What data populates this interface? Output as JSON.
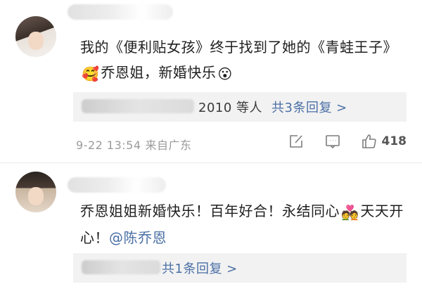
{
  "comments": [
    {
      "text_before": "我的《便利贴女孩》终于找到了她的《青蛙王子》",
      "emoji1": "🥰",
      "text_mid": "乔恩姐，新婚快乐",
      "emoji2": "😮",
      "reply_suffix": "2010 等人",
      "reply_count": "共3条回复 >",
      "timestamp": "9-22 13:54",
      "location": "来自广东",
      "likes": "418"
    },
    {
      "text_before": "乔恩姐姐新婚快乐！百年好合！永结同心",
      "emoji1": "💑",
      "text_mid": "天天开心！",
      "mention": "@陈乔恩",
      "reply_count": "共1条回复 >"
    }
  ],
  "icons": {
    "share": "share-icon",
    "comment": "comment-icon",
    "like": "thumbs-up-icon"
  },
  "colors": {
    "link": "#4a6fa5",
    "meta": "#9a9a9a",
    "reply_bg": "#f2f2f2"
  }
}
